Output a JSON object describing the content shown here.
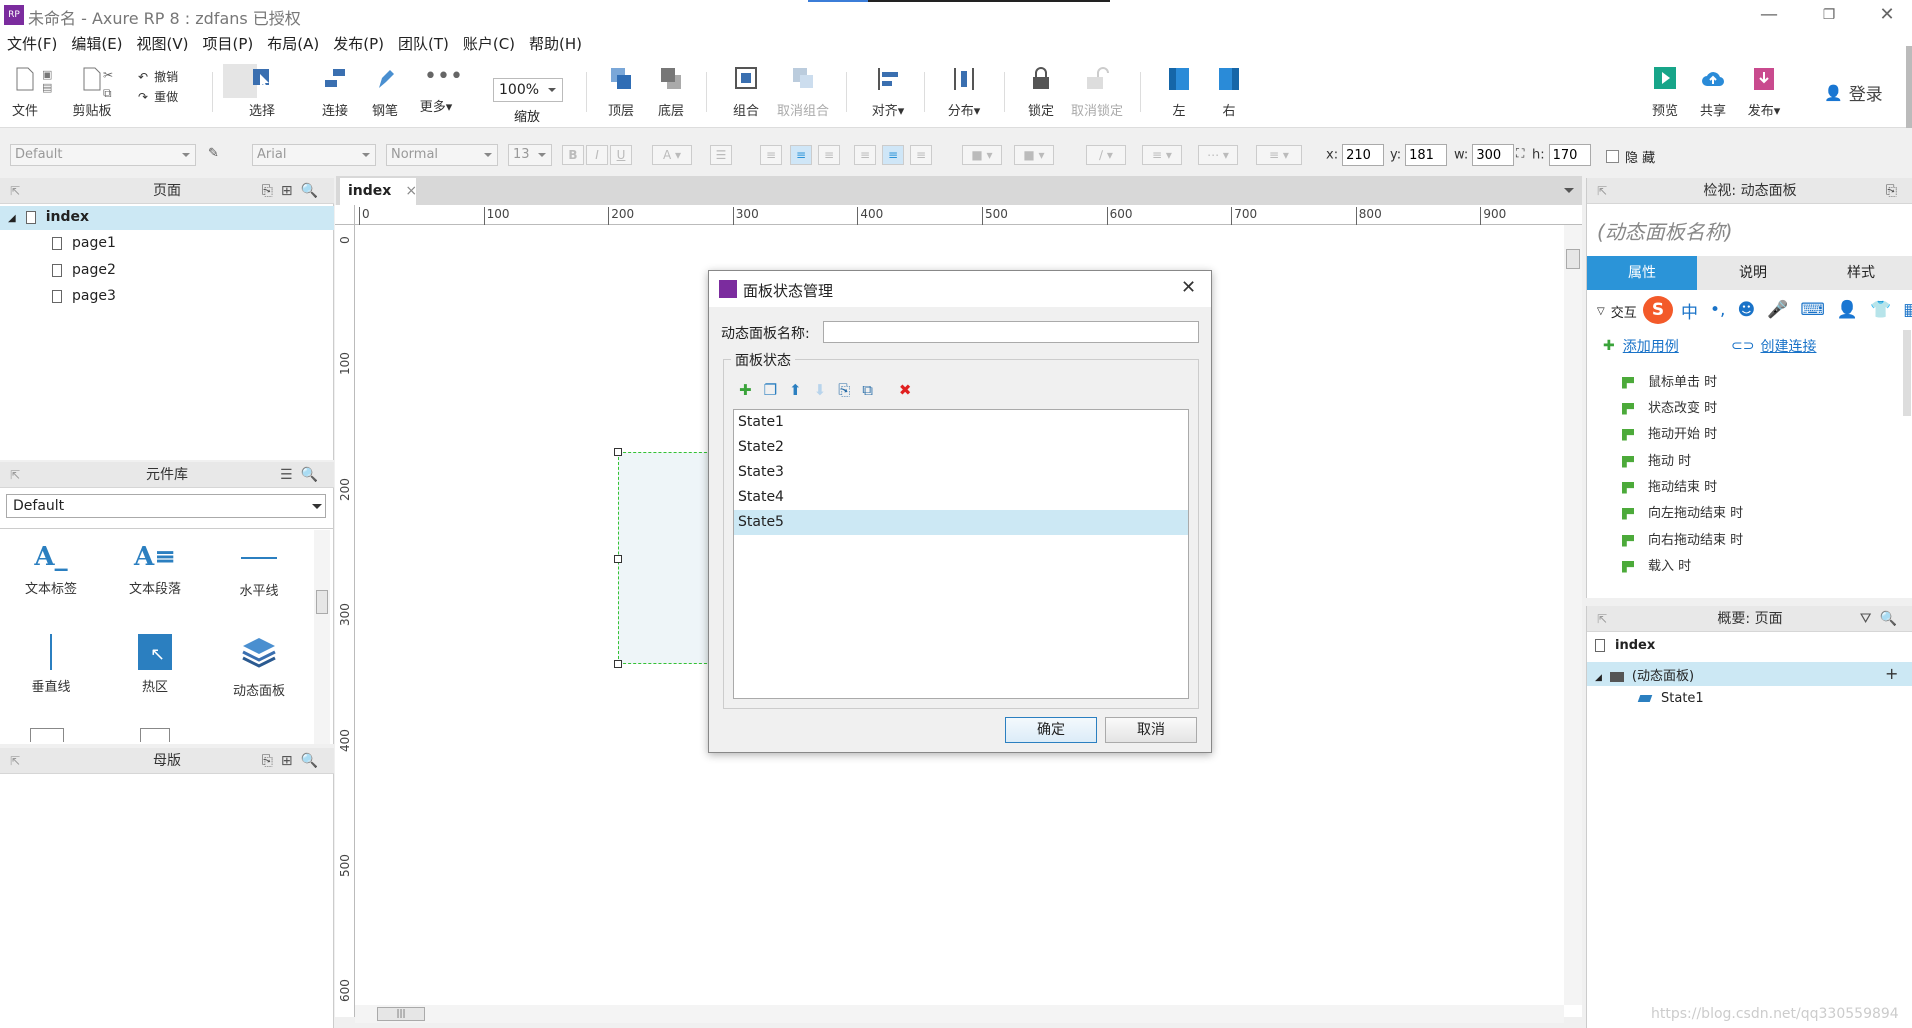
{
  "window": {
    "title": "未命名 - Axure RP 8 : zdfans 已授权",
    "logo": "RP"
  },
  "menu": [
    "文件(F)",
    "编辑(E)",
    "视图(V)",
    "项目(P)",
    "布局(A)",
    "发布(P)",
    "团队(T)",
    "账户(C)",
    "帮助(H)"
  ],
  "toolbar": {
    "file": "文件",
    "clipboard": "剪贴板",
    "undo": "撤销",
    "redo": "重做",
    "select": "选择",
    "connect": "连接",
    "pen": "钢笔",
    "more": "更多▾",
    "zoom_value": "100%",
    "zoom": "缩放",
    "top": "顶层",
    "bottom": "底层",
    "group": "组合",
    "ungroup": "取消组合",
    "align": "对齐▾",
    "distribute": "分布▾",
    "lock": "锁定",
    "unlock": "取消锁定",
    "left": "左",
    "right": "右",
    "preview": "预览",
    "share": "共享",
    "publish": "发布▾",
    "login": "登录"
  },
  "formatbar": {
    "style": "Default",
    "font": "Arial",
    "weight": "Normal",
    "size": "13",
    "x_label": "x:",
    "x": "210",
    "y_label": "y:",
    "y": "181",
    "w_label": "w:",
    "w": "300",
    "h_label": "h:",
    "h": "170",
    "hide": "隐 藏"
  },
  "pages_panel": {
    "title": "页面",
    "root": "index",
    "children": [
      "page1",
      "page2",
      "page3"
    ]
  },
  "library_panel": {
    "title": "元件库",
    "selected": "Default",
    "items": [
      "文本标签",
      "文本段落",
      "水平线",
      "垂直线",
      "热区",
      "动态面板"
    ]
  },
  "masters_panel": {
    "title": "母版"
  },
  "editor": {
    "tab": "index",
    "close": "×",
    "h_ticks": [
      "0",
      "100",
      "200",
      "300",
      "400",
      "500",
      "600",
      "700",
      "800",
      "900"
    ],
    "v_ticks": [
      "0",
      "100",
      "200",
      "300",
      "400",
      "500",
      "600"
    ]
  },
  "dialog": {
    "title": "面板状态管理",
    "name_label": "动态面板名称:",
    "name_value": "",
    "group_label": "面板状态",
    "states": [
      "State1",
      "State2",
      "State3",
      "State4",
      "State5"
    ],
    "selected_index": 4,
    "ok": "确定",
    "cancel": "取消",
    "close": "✕"
  },
  "inspector": {
    "title": "检视: 动态面板",
    "name_placeholder": "(动态面板名称)",
    "tabs": [
      "属性",
      "说明",
      "样式"
    ],
    "section": "交互",
    "add_case": "添加用例",
    "create_link": "创建连接",
    "events": [
      "鼠标单击 时",
      "状态改变 时",
      "拖动开始 时",
      "拖动 时",
      "拖动结束 时",
      "向左拖动结束 时",
      "向右拖动结束 时",
      "载入 时"
    ]
  },
  "outline": {
    "title": "概要: 页面",
    "root": "index",
    "panel": "(动态面板)",
    "state": "State1"
  },
  "watermark": "https://blog.csdn.net/qq330559894",
  "colors": {
    "accent": "#3a9de0",
    "selection": "#cce8f4",
    "tab_active": "#2b94d8"
  }
}
